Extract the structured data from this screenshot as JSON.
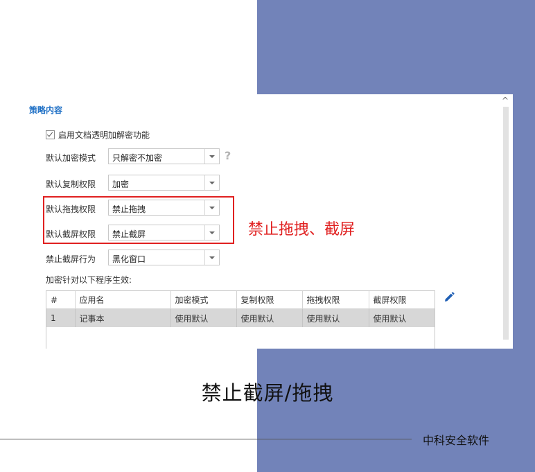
{
  "dialog": {
    "section_title": "策略内容",
    "enable_checkbox": {
      "label": "启用文档透明加解密功能",
      "checked": true
    },
    "rows": [
      {
        "label": "默认加密模式",
        "value": "只解密不加密"
      },
      {
        "label": "默认复制权限",
        "value": "加密"
      },
      {
        "label": "默认拖拽权限",
        "value": "禁止拖拽"
      },
      {
        "label": "默认截屏权限",
        "value": "禁止截屏"
      },
      {
        "label": "禁止截屏行为",
        "value": "黑化窗口"
      }
    ],
    "help_icon": "question-mark-icon",
    "apply_label": "加密针对以下程序生效:",
    "table": {
      "headers": [
        "#",
        "应用名",
        "加密模式",
        "复制权限",
        "拖拽权限",
        "截屏权限"
      ],
      "rows": [
        [
          "1",
          "记事本",
          "使用默认",
          "使用默认",
          "使用默认",
          "使用默认"
        ]
      ]
    },
    "edit_icon": "pencil-icon"
  },
  "annotation": {
    "text": "禁止拖拽、截屏",
    "color": "#e02020"
  },
  "slide": {
    "title": "禁止截屏/拖拽",
    "brand": "中科安全软件",
    "accent_color": "#7283b9"
  }
}
